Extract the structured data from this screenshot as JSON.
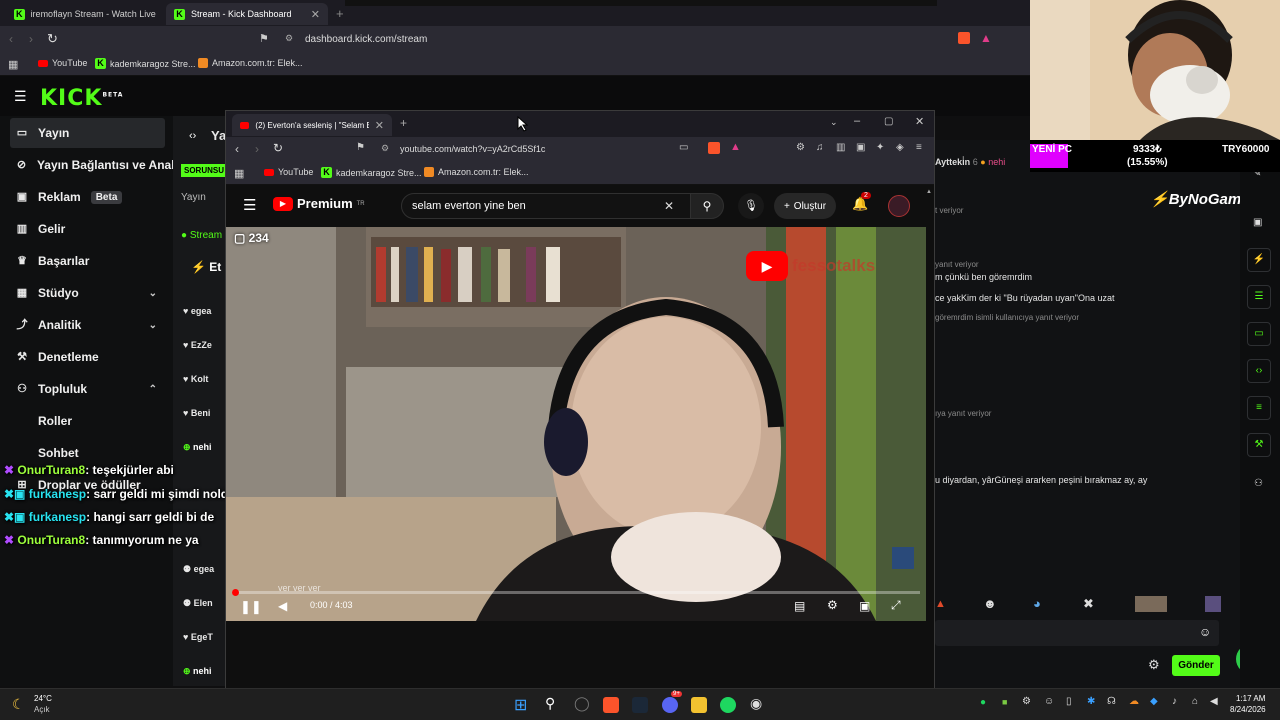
{
  "browser": {
    "tabs": [
      {
        "title": "iremoflayn Stream - Watch Live o"
      },
      {
        "title": "Stream - Kick Dashboard"
      }
    ],
    "url": "dashboard.kick.com/stream",
    "bookmarks": [
      "YouTube",
      "kademkaragoz Stre...",
      "Amazon.com.tr: Elek..."
    ]
  },
  "kick": {
    "logo": "KICK",
    "logo_sup": "BETA",
    "sidebar": [
      {
        "label": "Yayın",
        "icon": "play-icon"
      },
      {
        "label": "Yayın Bağlantısı ve Anahtar",
        "icon": "link-icon"
      },
      {
        "label": "Reklam",
        "icon": "ad-icon",
        "badge": "Beta"
      },
      {
        "label": "Gelir",
        "icon": "chart-icon"
      },
      {
        "label": "Başarılar",
        "icon": "trophy-icon"
      },
      {
        "label": "Stüdyo",
        "icon": "grid-icon"
      },
      {
        "label": "Analitik",
        "icon": "analytics-icon"
      },
      {
        "label": "Denetleme",
        "icon": "hammer-icon"
      },
      {
        "label": "Topluluk",
        "icon": "people-icon"
      },
      {
        "label": "Roller",
        "icon": ""
      },
      {
        "label": "Sohbet",
        "icon": ""
      },
      {
        "label": "Droplar ve ödüller",
        "icon": "gift-icon"
      }
    ],
    "middle": {
      "header": "Yay",
      "status": "SORUNSU",
      "sub": "Yayın",
      "stream_ok": "Stream",
      "events_title": "Et",
      "events": [
        "egea",
        "EzZe",
        "Kolt",
        "Beni",
        "nehi",
        "egea",
        "Elen",
        "EgeT",
        "nehi"
      ]
    },
    "chat_overlay": [
      {
        "user": "OnurTuran8",
        "text": ": teşekjürler abi"
      },
      {
        "user": "furkanesp",
        "text": ": sarr geldi mi şimdi noldu"
      },
      {
        "user": "furkanesp",
        "text": ": hangi sarr geldi bi de"
      },
      {
        "user": "OnurTuran8",
        "text": ": tanımıyorum ne ya"
      }
    ],
    "chat_panel": {
      "header_user": "Aytteki̇n",
      "header_count": "6",
      "header_user2": "nehi",
      "messages": [
        "t veriyor",
        "yanıt veriyor",
        "m çünkü ben göremrdim",
        "ce yakKim der ki \"Bu rüyadan uyan\"Ona uzat",
        "göremrdim isimli kullanıcıya yanıt veriyor",
        "ıya yanıt veriyor",
        "u diyardan, yârGüneşi ararken peşini bırakmaz ay, ay"
      ],
      "send_button": "Gönder"
    },
    "ad_logo": "ByNoGame"
  },
  "webcam": {
    "stats": {
      "label": "YENİ PC",
      "amount": "9333₺",
      "percent": "(15.55%)",
      "goal": "TRY60000"
    }
  },
  "youtube_window": {
    "tab_title": "(2) Everton'a sesleniş | \"Selam Ev",
    "url": "youtube.com/watch?v=yA2rCd5Sf1c",
    "bookmarks": [
      "YouTube",
      "kademkaragoz Stre...",
      "Amazon.com.tr: Elek..."
    ],
    "brand": "Premium",
    "brand_sup": "TR",
    "search_value": "selam everton yine ben",
    "create_label": "Oluştur",
    "notification_count": "2",
    "video": {
      "overlay_count": "234",
      "watermark": "fessotalks",
      "caption": "ver ver ver",
      "time": "0:00 / 4:03",
      "progress": 0.0
    }
  },
  "taskbar": {
    "weather_temp": "24°C",
    "weather_desc": "Açık",
    "time": "1:17 AM",
    "date": "8/24/2026",
    "discord_badge": "9+"
  }
}
